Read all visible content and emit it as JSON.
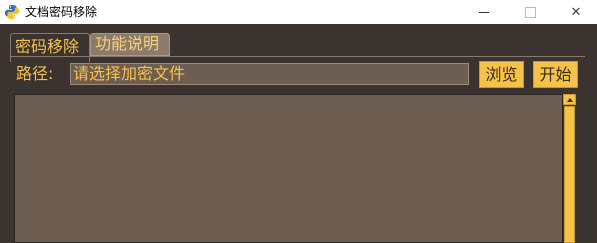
{
  "window": {
    "title": "文档密码移除",
    "icon": "python-icon",
    "minimize_icon": "minimize-icon",
    "maximize_icon": "maximize-icon",
    "close_glyph": "✕"
  },
  "tabs": [
    {
      "label": "密码移除",
      "active": true
    },
    {
      "label": "功能说明",
      "active": false
    }
  ],
  "path": {
    "label": "路径:",
    "placeholder": "请选择加密文件"
  },
  "buttons": {
    "browse": "浏览",
    "start": "开始"
  },
  "colors": {
    "accent": "#f5c24a",
    "background": "#3a3330",
    "field": "#6e5e52"
  }
}
